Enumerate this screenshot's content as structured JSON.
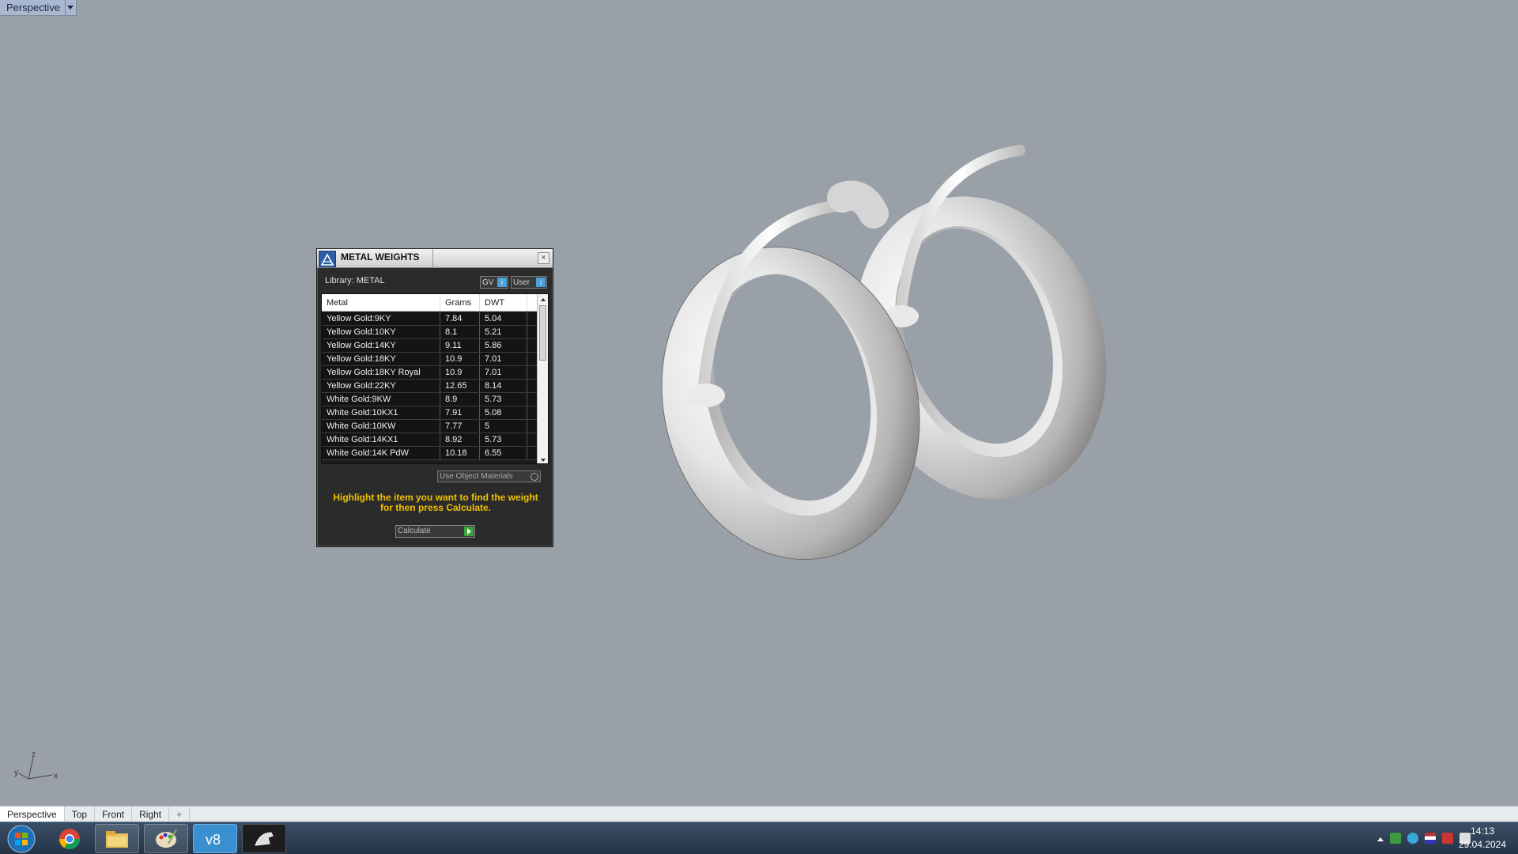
{
  "viewport": {
    "title": "Perspective",
    "axes": {
      "x": "x",
      "y": "y",
      "z": "z"
    }
  },
  "dialog": {
    "title": "METAL WEIGHTS",
    "close_glyph": "×",
    "library_label": "Library: METAL",
    "toggle_gv": "GV",
    "toggle_user": "User",
    "toggle_mark": "i",
    "columns": [
      "Metal",
      "Grams",
      "DWT"
    ],
    "rows": [
      {
        "metal": "Yellow Gold:9KY",
        "grams": "7.84",
        "dwt": "5.04"
      },
      {
        "metal": "Yellow Gold:10KY",
        "grams": "8.1",
        "dwt": "5.21"
      },
      {
        "metal": "Yellow Gold:14KY",
        "grams": "9.11",
        "dwt": "5.86"
      },
      {
        "metal": "Yellow Gold:18KY",
        "grams": "10.9",
        "dwt": "7.01"
      },
      {
        "metal": "Yellow Gold:18KY Royal",
        "grams": "10.9",
        "dwt": "7.01"
      },
      {
        "metal": "Yellow Gold:22KY",
        "grams": "12.65",
        "dwt": "8.14"
      },
      {
        "metal": "White Gold:9KW",
        "grams": "8.9",
        "dwt": "5.73"
      },
      {
        "metal": "White Gold:10KX1",
        "grams": "7.91",
        "dwt": "5.08"
      },
      {
        "metal": "White Gold:10KW",
        "grams": "7.77",
        "dwt": "5"
      },
      {
        "metal": "White Gold:14KX1",
        "grams": "8.92",
        "dwt": "5.73"
      },
      {
        "metal": "White Gold:14K PdW",
        "grams": "10.18",
        "dwt": "6.55"
      }
    ],
    "use_object_materials": "Use Object Materials",
    "hint": "Highlight the item you want to find the weight for then press Calculate.",
    "calculate_label": "Calculate"
  },
  "tabs": [
    {
      "label": "Perspective",
      "active": true
    },
    {
      "label": "Top"
    },
    {
      "label": "Front"
    },
    {
      "label": "Right"
    }
  ],
  "tabs_add": "+",
  "taskbar": {
    "time": "14:13",
    "date": "29.04.2024"
  },
  "colors": {
    "viewport_bg": "#9aa0a8",
    "dialog_bg": "#2b2b2b",
    "hint": "#f0c000",
    "toggle_on": "#4aa0d8"
  }
}
